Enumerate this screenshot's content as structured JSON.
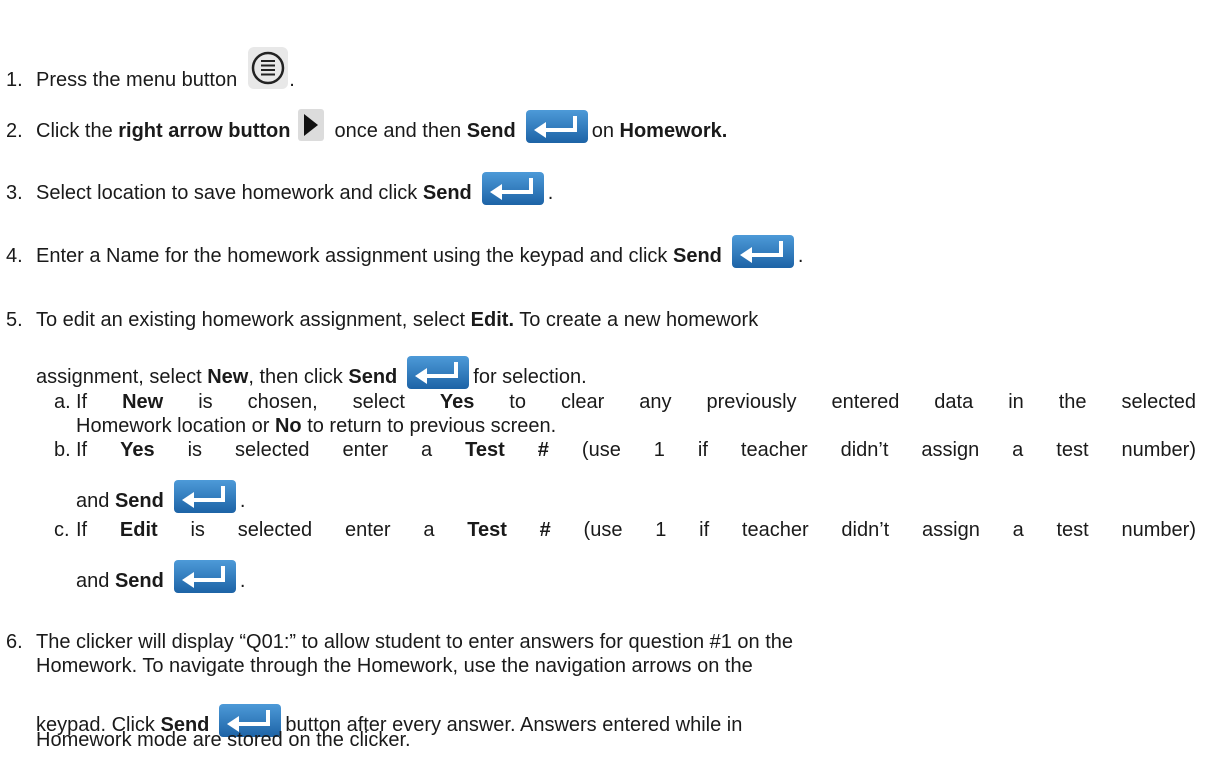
{
  "steps": {
    "s1": {
      "num": "1.",
      "text": "Press the menu button",
      "end": "."
    },
    "s2": {
      "num": "2.",
      "t1": "Click the ",
      "b1": "right arrow button",
      "t2": "once and then ",
      "b2": "Send",
      "t3": "on ",
      "b3": "Homework."
    },
    "s3": {
      "num": "3.",
      "t1": "Select location to save homework and click ",
      "b1": "Send",
      "end": "."
    },
    "s4": {
      "num": "4.",
      "t1": "Enter a Name for the homework assignment using the keypad and click ",
      "b1": "Send",
      "end": "."
    },
    "s5": {
      "num": "5.",
      "line1_t1": "To edit an existing homework assignment, select ",
      "line1_b1": "Edit.",
      "line1_t2": " To create a new homework",
      "line2_t1": "assignment, select ",
      "line2_b1": "New",
      "line2_t2": ", then click ",
      "line2_b2": "Send",
      "line2_t3": "for selection."
    },
    "sa": {
      "letter": "a.",
      "t1": "If ",
      "b1": "New",
      "t2": " is chosen, select ",
      "b2": "Yes",
      "t3": " to clear any previously entered data in the selected",
      "line2_t1": "Homework location or ",
      "line2_b1": "No",
      "line2_t2": " to return to previous screen."
    },
    "sb": {
      "letter": "b.",
      "t1": "If ",
      "b1": "Yes",
      "t2": " is selected enter a ",
      "b2": "Test #",
      "t3": " (use 1 if teacher didn’t assign a test number)",
      "line2_t1": "and ",
      "line2_b1": "Send",
      "end": "."
    },
    "sc": {
      "letter": "c.",
      "t1": "If ",
      "b1": "Edit",
      "t2": " is selected enter a ",
      "b2": "Test #",
      "t3": " (use 1 if teacher didn’t assign a test number)",
      "line2_t1": "and ",
      "line2_b1": "Send",
      "end": "."
    },
    "s6": {
      "num": "6.",
      "line1": "The clicker will display “Q01:” to allow student to enter answers for question #1 on the",
      "line2": "Homework.  To navigate through the Homework, use the navigation arrows on the",
      "line3_t1": "keypad.  Click ",
      "line3_b1": "Send",
      "line3_t2": "button after every answer.  Answers entered while in",
      "line4": "Homework mode are stored on the clicker."
    }
  },
  "icons": {
    "send": "send-enter-icon",
    "arrow": "right-arrow-icon",
    "menu": "menu-icon"
  },
  "colors": {
    "send_blue": "#2a7ac0",
    "text": "#1a1a1a"
  }
}
